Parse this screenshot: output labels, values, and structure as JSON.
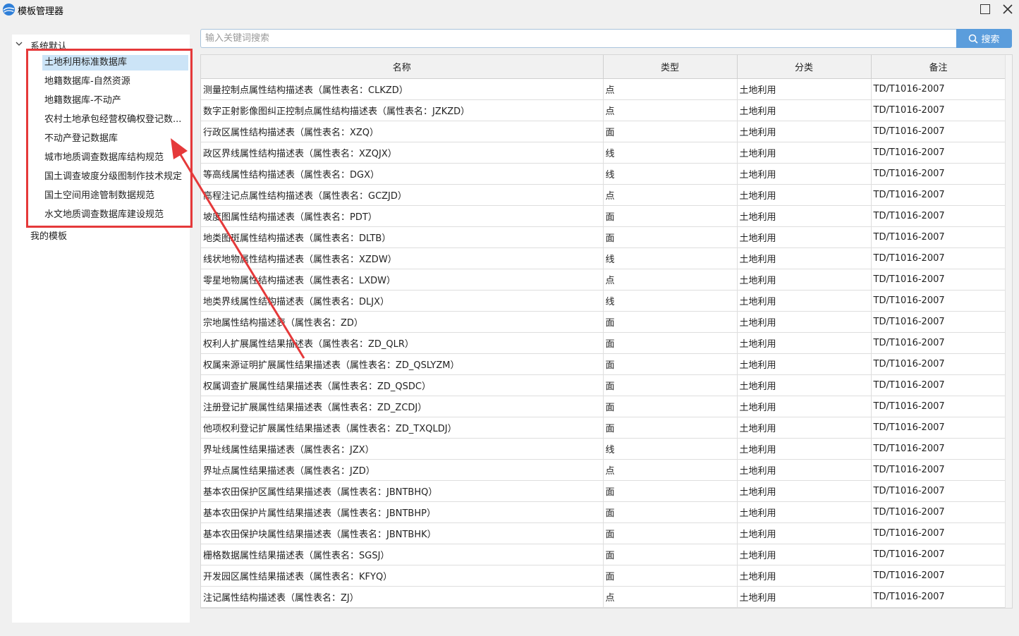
{
  "window": {
    "title": "模板管理器"
  },
  "tree": {
    "root_label": "系统默认",
    "items": [
      {
        "label": "土地利用标准数据库"
      },
      {
        "label": "地籍数据库-自然资源"
      },
      {
        "label": "地籍数据库-不动产"
      },
      {
        "label": "农村土地承包经营权确权登记数..."
      },
      {
        "label": "不动产登记数据库"
      },
      {
        "label": "城市地质调查数据库结构规范"
      },
      {
        "label": "国土调查坡度分级图制作技术规定"
      },
      {
        "label": "国土空间用途管制数据规范"
      },
      {
        "label": "水文地质调查数据库建设规范"
      }
    ],
    "root2_label": "我的模板"
  },
  "search": {
    "placeholder": "输入关键词搜索",
    "button_label": "搜索"
  },
  "table": {
    "headers": {
      "name": "名称",
      "type": "类型",
      "category": "分类",
      "note": "备注"
    },
    "rows": [
      {
        "name": "测量控制点属性结构描述表（属性表名：CLKZD）",
        "type": "点",
        "category": "土地利用",
        "note": "TD/T1016-2007"
      },
      {
        "name": "数字正射影像图纠正控制点属性结构描述表（属性表名：JZKZD）",
        "type": "点",
        "category": "土地利用",
        "note": "TD/T1016-2007"
      },
      {
        "name": "行政区属性结构描述表（属性表名：XZQ）",
        "type": "面",
        "category": "土地利用",
        "note": "TD/T1016-2007"
      },
      {
        "name": "政区界线属性结构描述表（属性表名：XZQJX）",
        "type": "线",
        "category": "土地利用",
        "note": "TD/T1016-2007"
      },
      {
        "name": "等高线属性结构描述表（属性表名：DGX）",
        "type": "线",
        "category": "土地利用",
        "note": "TD/T1016-2007"
      },
      {
        "name": "高程注记点属性结构描述表（属性表名：GCZJD）",
        "type": "点",
        "category": "土地利用",
        "note": "TD/T1016-2007"
      },
      {
        "name": "坡度图属性结构描述表（属性表名：PDT）",
        "type": "面",
        "category": "土地利用",
        "note": "TD/T1016-2007"
      },
      {
        "name": "地类图斑属性结构描述表（属性表名：DLTB）",
        "type": "面",
        "category": "土地利用",
        "note": "TD/T1016-2007"
      },
      {
        "name": "线状地物属性结构描述表（属性表名：XZDW）",
        "type": "线",
        "category": "土地利用",
        "note": "TD/T1016-2007"
      },
      {
        "name": "零星地物属性结构描述表（属性表名：LXDW）",
        "type": "点",
        "category": "土地利用",
        "note": "TD/T1016-2007"
      },
      {
        "name": "地类界线属性结构描述表（属性表名：DLJX）",
        "type": "线",
        "category": "土地利用",
        "note": "TD/T1016-2007"
      },
      {
        "name": "宗地属性结构描述表（属性表名：ZD）",
        "type": "面",
        "category": "土地利用",
        "note": "TD/T1016-2007"
      },
      {
        "name": "权利人扩展属性结果描述表（属性表名：ZD_QLR）",
        "type": "面",
        "category": "土地利用",
        "note": "TD/T1016-2007"
      },
      {
        "name": "权属来源证明扩展属性结果描述表（属性表名：ZD_QSLYZM）",
        "type": "面",
        "category": "土地利用",
        "note": "TD/T1016-2007"
      },
      {
        "name": "权属调查扩展属性结果描述表（属性表名：ZD_QSDC）",
        "type": "面",
        "category": "土地利用",
        "note": "TD/T1016-2007"
      },
      {
        "name": "注册登记扩展属性结果描述表（属性表名：ZD_ZCDJ）",
        "type": "面",
        "category": "土地利用",
        "note": "TD/T1016-2007"
      },
      {
        "name": "他项权利登记扩展属性结果描述表（属性表名：ZD_TXQLDJ）",
        "type": "面",
        "category": "土地利用",
        "note": "TD/T1016-2007"
      },
      {
        "name": "界址线属性结果描述表（属性表名：JZX）",
        "type": "线",
        "category": "土地利用",
        "note": "TD/T1016-2007"
      },
      {
        "name": "界址点属性结果描述表（属性表名：JZD）",
        "type": "点",
        "category": "土地利用",
        "note": "TD/T1016-2007"
      },
      {
        "name": "基本农田保护区属性结果描述表（属性表名：JBNTBHQ）",
        "type": "面",
        "category": "土地利用",
        "note": "TD/T1016-2007"
      },
      {
        "name": "基本农田保护片属性结果描述表（属性表名：JBNTBHP）",
        "type": "面",
        "category": "土地利用",
        "note": "TD/T1016-2007"
      },
      {
        "name": "基本农田保护块属性结果描述表（属性表名：JBNTBHK）",
        "type": "面",
        "category": "土地利用",
        "note": "TD/T1016-2007"
      },
      {
        "name": "栅格数据属性结果描述表（属性表名：SGSJ）",
        "type": "面",
        "category": "土地利用",
        "note": "TD/T1016-2007"
      },
      {
        "name": "开发园区属性结果描述表（属性表名：KFYQ）",
        "type": "面",
        "category": "土地利用",
        "note": "TD/T1016-2007"
      },
      {
        "name": "注记属性结构描述表（属性表名：ZJ）",
        "type": "点",
        "category": "土地利用",
        "note": "TD/T1016-2007"
      }
    ]
  },
  "colors": {
    "selection": "#cce4f7",
    "accent": "#5b9ddc",
    "annotation": "#e5393a"
  },
  "icons": {
    "app": "app-logo-icon",
    "maximize": "maximize-icon",
    "close": "close-icon",
    "expand": "chevron-down-icon",
    "search": "search-icon"
  }
}
